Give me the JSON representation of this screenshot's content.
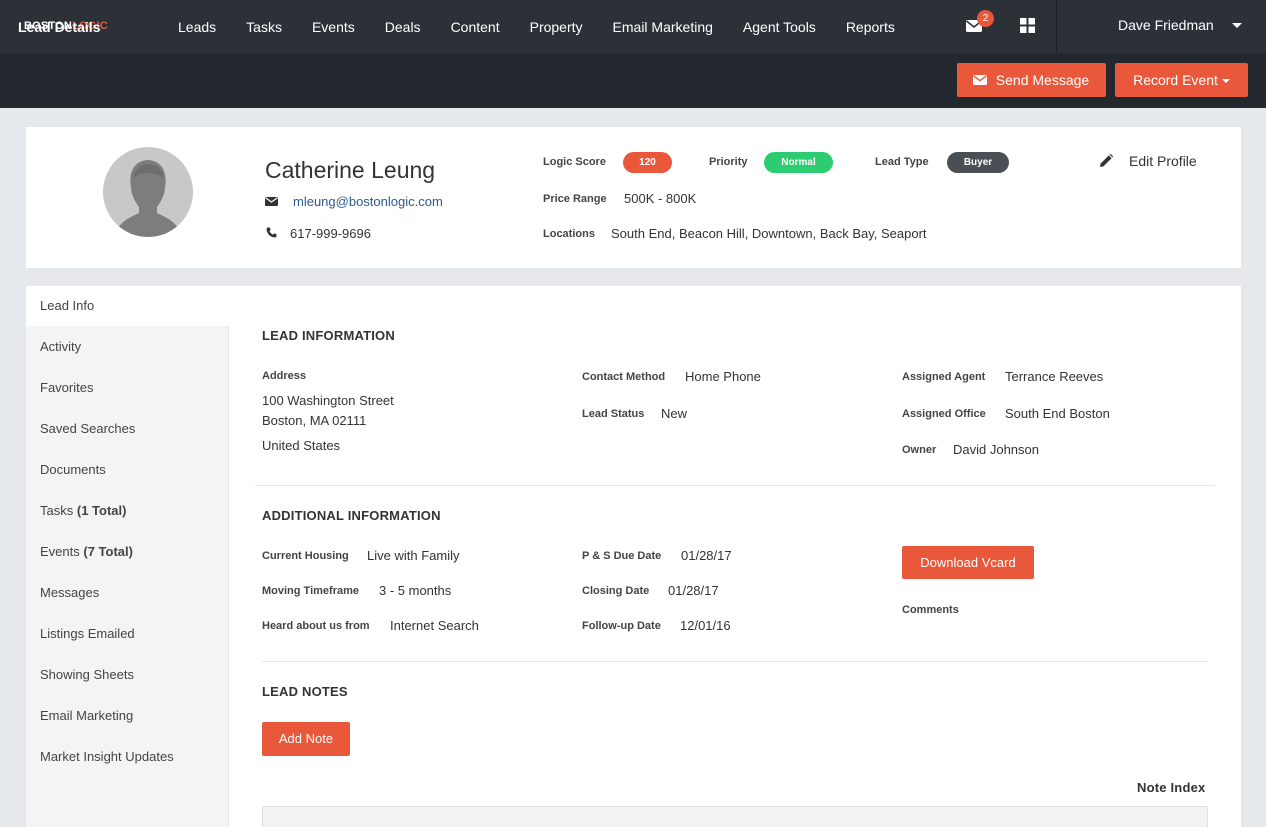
{
  "app": {
    "logo_part1": "BOSTON",
    "logo_part2": "LOGIC"
  },
  "nav": {
    "items": [
      "Leads",
      "Tasks",
      "Events",
      "Deals",
      "Content",
      "Property",
      "Email Marketing",
      "Agent Tools",
      "Reports"
    ],
    "mail_badge": "2",
    "user_name": "Dave Friedman"
  },
  "subheader": {
    "title": "Lead Details",
    "send_message": "Send Message",
    "record_event": "Record Event"
  },
  "profile": {
    "name": "Catherine Leung",
    "email": "mleung@bostonlogic.com",
    "phone": "617-999-9696",
    "logic_score_label": "Logic Score",
    "logic_score": "120",
    "priority_label": "Priority",
    "priority": "Normal",
    "lead_type_label": "Lead Type",
    "lead_type": "Buyer",
    "price_range_label": "Price Range",
    "price_range": "500K - 800K",
    "locations_label": "Locations",
    "locations": "South End, Beacon Hill, Downtown, Back Bay, Seaport",
    "edit_profile": "Edit Profile"
  },
  "sidebar": {
    "items": [
      {
        "label": "Lead Info",
        "count": ""
      },
      {
        "label": "Activity",
        "count": ""
      },
      {
        "label": "Favorites",
        "count": ""
      },
      {
        "label": "Saved Searches",
        "count": ""
      },
      {
        "label": "Documents",
        "count": ""
      },
      {
        "label": "Tasks",
        "count": "(1 Total)"
      },
      {
        "label": "Events",
        "count": "(7 Total)"
      },
      {
        "label": "Messages",
        "count": ""
      },
      {
        "label": "Listings Emailed",
        "count": ""
      },
      {
        "label": "Showing Sheets",
        "count": ""
      },
      {
        "label": "Email Marketing",
        "count": ""
      },
      {
        "label": "Market Insight Updates",
        "count": ""
      }
    ]
  },
  "lead_info": {
    "title": "LEAD INFORMATION",
    "address_label": "Address",
    "address_line1": "100 Washington Street",
    "address_line2": "Boston, MA 02111",
    "address_line3": "United States",
    "contact_method_label": "Contact Method",
    "contact_method": "Home Phone",
    "lead_status_label": "Lead Status",
    "lead_status": "New",
    "assigned_agent_label": "Assigned Agent",
    "assigned_agent": "Terrance Reeves",
    "assigned_office_label": "Assigned Office",
    "assigned_office": "South End Boston",
    "owner_label": "Owner",
    "owner": "David Johnson"
  },
  "additional_info": {
    "title": "ADDITIONAL INFORMATION",
    "current_housing_label": "Current Housing",
    "current_housing": "Live with Family",
    "moving_timeframe_label": "Moving Timeframe",
    "moving_timeframe": "3 - 5 months",
    "heard_label": "Heard about us from",
    "heard": "Internet Search",
    "ps_due_label": "P & S Due Date",
    "ps_due": "01/28/17",
    "closing_label": "Closing Date",
    "closing": "01/28/17",
    "followup_label": "Follow-up Date",
    "followup": "12/01/16",
    "download_vcard": "Download Vcard",
    "comments_label": "Comments"
  },
  "lead_notes": {
    "title": "LEAD NOTES",
    "add_note": "Add Note",
    "note_index": "Note Index"
  },
  "colors": {
    "accent": "#e9583a",
    "nav_bg": "#2c3138",
    "subbar_bg": "#23282e",
    "priority_green": "#2ecc71",
    "lead_type_dark": "#4a4f55"
  }
}
